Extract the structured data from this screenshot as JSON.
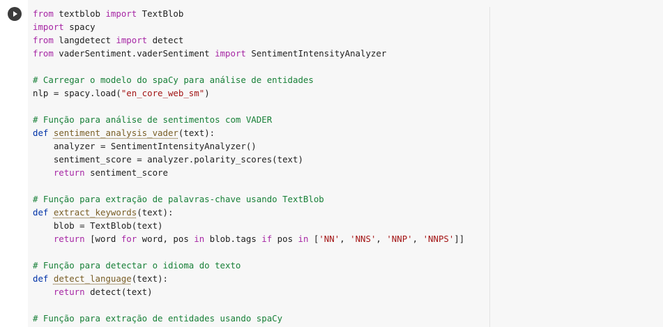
{
  "cell": {
    "run_button_icon": "play-icon",
    "code_lines": [
      [
        {
          "t": "kw",
          "v": "from"
        },
        {
          "t": "plain",
          "v": " textblob "
        },
        {
          "t": "kw",
          "v": "import"
        },
        {
          "t": "plain",
          "v": " TextBlob"
        }
      ],
      [
        {
          "t": "kw",
          "v": "import"
        },
        {
          "t": "plain",
          "v": " spacy"
        }
      ],
      [
        {
          "t": "kw",
          "v": "from"
        },
        {
          "t": "plain",
          "v": " langdetect "
        },
        {
          "t": "kw",
          "v": "import"
        },
        {
          "t": "plain",
          "v": " detect"
        }
      ],
      [
        {
          "t": "kw",
          "v": "from"
        },
        {
          "t": "plain",
          "v": " vaderSentiment.vaderSentiment "
        },
        {
          "t": "kw",
          "v": "import"
        },
        {
          "t": "plain",
          "v": " SentimentIntensityAnalyzer"
        }
      ],
      [],
      [
        {
          "t": "com",
          "v": "# Carregar o modelo do spaCy para análise de entidades"
        }
      ],
      [
        {
          "t": "plain",
          "v": "nlp = spacy.load("
        },
        {
          "t": "str",
          "v": "\"en_core_web_sm\""
        },
        {
          "t": "plain",
          "v": ")"
        }
      ],
      [],
      [
        {
          "t": "com",
          "v": "# Função para análise de sentimentos com VADER"
        }
      ],
      [
        {
          "t": "def",
          "v": "def"
        },
        {
          "t": "plain",
          "v": " "
        },
        {
          "t": "fn",
          "v": "sentiment_analysis_vader"
        },
        {
          "t": "plain",
          "v": "(text):"
        }
      ],
      [
        {
          "t": "plain",
          "v": "    analyzer = SentimentIntensityAnalyzer()"
        }
      ],
      [
        {
          "t": "plain",
          "v": "    sentiment_score = analyzer.polarity_scores(text)"
        }
      ],
      [
        {
          "t": "plain",
          "v": "    "
        },
        {
          "t": "kw",
          "v": "return"
        },
        {
          "t": "plain",
          "v": " sentiment_score"
        }
      ],
      [],
      [
        {
          "t": "com",
          "v": "# Função para extração de palavras-chave usando TextBlob"
        }
      ],
      [
        {
          "t": "def",
          "v": "def"
        },
        {
          "t": "plain",
          "v": " "
        },
        {
          "t": "fn",
          "v": "extract_keywords"
        },
        {
          "t": "plain",
          "v": "(text):"
        }
      ],
      [
        {
          "t": "plain",
          "v": "    blob = TextBlob(text)"
        }
      ],
      [
        {
          "t": "plain",
          "v": "    "
        },
        {
          "t": "kw",
          "v": "return"
        },
        {
          "t": "plain",
          "v": " [word "
        },
        {
          "t": "kw",
          "v": "for"
        },
        {
          "t": "plain",
          "v": " word, pos "
        },
        {
          "t": "kw",
          "v": "in"
        },
        {
          "t": "plain",
          "v": " blob.tags "
        },
        {
          "t": "kw",
          "v": "if"
        },
        {
          "t": "plain",
          "v": " pos "
        },
        {
          "t": "kw",
          "v": "in"
        },
        {
          "t": "plain",
          "v": " ["
        },
        {
          "t": "str",
          "v": "'NN'"
        },
        {
          "t": "plain",
          "v": ", "
        },
        {
          "t": "str",
          "v": "'NNS'"
        },
        {
          "t": "plain",
          "v": ", "
        },
        {
          "t": "str",
          "v": "'NNP'"
        },
        {
          "t": "plain",
          "v": ", "
        },
        {
          "t": "str",
          "v": "'NNPS'"
        },
        {
          "t": "plain",
          "v": "]]"
        }
      ],
      [],
      [
        {
          "t": "com",
          "v": "# Função para detectar o idioma do texto"
        }
      ],
      [
        {
          "t": "def",
          "v": "def"
        },
        {
          "t": "plain",
          "v": " "
        },
        {
          "t": "fn",
          "v": "detect_language"
        },
        {
          "t": "plain",
          "v": "(text):"
        }
      ],
      [
        {
          "t": "plain",
          "v": "    "
        },
        {
          "t": "kw",
          "v": "return"
        },
        {
          "t": "plain",
          "v": " detect(text)"
        }
      ],
      [],
      [
        {
          "t": "com",
          "v": "# Função para extração de entidades usando spaCy"
        }
      ]
    ]
  },
  "colors": {
    "keyword": "#a626a4",
    "def": "#0033a8",
    "string": "#a31515",
    "comment": "#188038",
    "function": "#795e26",
    "text": "#212121",
    "editor_bg": "#f7f7f7"
  }
}
